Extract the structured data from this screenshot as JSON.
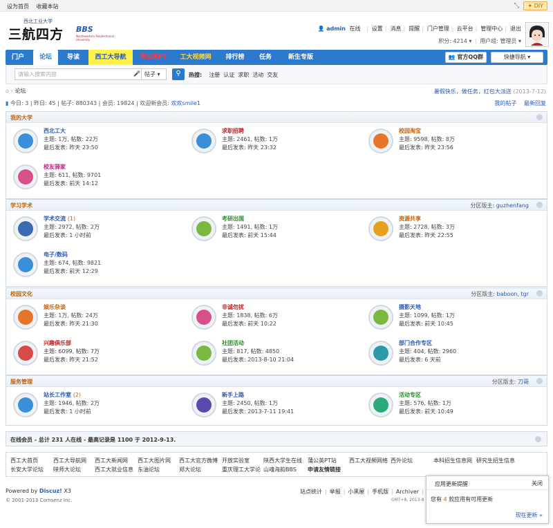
{
  "topbar": {
    "set_home": "设为首页",
    "favorite": "收藏本站",
    "diy": "DIY"
  },
  "logo": {
    "school": "西北工业大学",
    "name": "三航四方",
    "bbs": "BBS",
    "english": "Northwestern Polytechnical University"
  },
  "user": {
    "name": "admin",
    "status": "在线",
    "links": [
      "设置",
      "消息",
      "提醒",
      "门户管理",
      "云平台",
      "管理中心",
      "退出"
    ],
    "points_label": "积分:",
    "points": "4214",
    "group_label": "用户组:",
    "group": "管理员"
  },
  "nav": {
    "items": [
      "门户",
      "论坛",
      "导读",
      "西工大导航",
      "蒲公英PT",
      "工大视频网",
      "排行榜",
      "任务",
      "新生专版"
    ],
    "active": "论坛",
    "qq": "官方QQ群",
    "quicknav": "快捷导航"
  },
  "search": {
    "placeholder": "请输入搜索内容",
    "type": "帖子",
    "hot_label": "热搜:",
    "hot": [
      "注册",
      "认证",
      "求职",
      "活动",
      "交友"
    ]
  },
  "breadcrumb": {
    "current": "论坛",
    "notice": "暑假快乐，做任务，红包大派送",
    "notice_date": "(2013-7-12)"
  },
  "stats": {
    "text": "今日: 3 | 昨日: 45 | 帖子: 880343 | 会员: 19824 | 欢迎新会员:",
    "new_member": "欢欢smile1",
    "my_posts": "我的帖子",
    "latest": "最新回复"
  },
  "sections": [
    {
      "title": "我的大学",
      "mods": "",
      "forums": [
        {
          "name": "西北工大",
          "extra": "",
          "color": "#2b5ab0",
          "icon": "#3a8fd8",
          "topics": "主题: 1万, 帖数: 22万",
          "last": "最后发表: 昨天 23:50"
        },
        {
          "name": "求职招聘",
          "extra": "",
          "color": "#c02020",
          "icon": "#3a8fd8",
          "topics": "主题: 2461, 帖数: 1万",
          "last": "最后发表: 昨天 23:32"
        },
        {
          "name": "校园淘宝",
          "extra": "",
          "color": "#c0620c",
          "icon": "#e8742a",
          "topics": "主题: 9598, 帖数: 8万",
          "last": "最后发表: 昨天 23:56"
        },
        {
          "name": "校友驿家",
          "extra": "",
          "color": "#c02080",
          "icon": "#d8508a",
          "topics": "主题: 611, 帖数: 9701",
          "last": "最后发表: 前天 14:12"
        }
      ]
    },
    {
      "title": "学习学术",
      "mods": "guzhenfang",
      "forums": [
        {
          "name": "学术交流",
          "extra": "(1)",
          "color": "#2b5ab0",
          "icon": "#3a6ab0",
          "topics": "主题: 2972, 帖数: 2万",
          "last": "最后发表: 1 小时前"
        },
        {
          "name": "考研出国",
          "extra": "",
          "color": "#2a8a2a",
          "icon": "#7ab840",
          "topics": "主题: 1491, 帖数: 1万",
          "last": "最后发表: 前天 15:44"
        },
        {
          "name": "资源共享",
          "extra": "",
          "color": "#c0620c",
          "icon": "#e8a020",
          "topics": "主题: 2728, 帖数: 3万",
          "last": "最后发表: 昨天 22:55"
        },
        {
          "name": "电子/数码",
          "extra": "",
          "color": "#2b5ab0",
          "icon": "#3a8fd8",
          "topics": "主题: 674, 帖数: 9821",
          "last": "最后发表: 前天 12:29"
        }
      ]
    },
    {
      "title": "校园文化",
      "mods": "baboon, tgr",
      "forums": [
        {
          "name": "娱乐杂谈",
          "extra": "",
          "color": "#c0620c",
          "icon": "#e8742a",
          "topics": "主题: 1万, 帖数: 24万",
          "last": "最后发表: 昨天 21:30"
        },
        {
          "name": "非诚勿扰",
          "extra": "",
          "color": "#c02020",
          "icon": "#d8508a",
          "topics": "主题: 1838, 帖数: 6万",
          "last": "最后发表: 前天 10:22"
        },
        {
          "name": "摄影天地",
          "extra": "",
          "color": "#2b5ab0",
          "icon": "#7ab840",
          "topics": "主题: 1099, 帖数: 1万",
          "last": "最后发表: 前天 10:45"
        },
        {
          "name": "兴趣俱乐部",
          "extra": "",
          "color": "#c02020",
          "icon": "#d84a4a",
          "topics": "主题: 6099, 帖数: 7万",
          "last": "最后发表: 昨天 21:52"
        },
        {
          "name": "社团活动",
          "extra": "",
          "color": "#2a8a2a",
          "icon": "#7ab840",
          "topics": "主题: 817, 帖数: 4850",
          "last": "最后发表: 2013-8-10 21:04"
        },
        {
          "name": "部门合作专区",
          "extra": "",
          "color": "#2b5ab0",
          "icon": "#2a9aaa",
          "topics": "主题: 404, 帖数: 2960",
          "last": "最后发表: 6 天前"
        }
      ]
    },
    {
      "title": "服务管理",
      "mods": "刀哥",
      "forums": [
        {
          "name": "站长工作室",
          "extra": "(2)",
          "color": "#2b5ab0",
          "icon": "#3a8fd8",
          "topics": "主题: 1946, 帖数: 2万",
          "last": "最后发表: 1 小时前"
        },
        {
          "name": "新手上路",
          "extra": "",
          "color": "#2b5ab0",
          "icon": "#5a4ab0",
          "topics": "主题: 2450, 帖数: 1万",
          "last": "最后发表: 2013-7-11 19:41"
        },
        {
          "name": "活动专区",
          "extra": "",
          "color": "#2a8a2a",
          "icon": "#2aaa7a",
          "topics": "主题: 576, 帖数: 1万",
          "last": "最后发表: 前天 10:49"
        }
      ]
    }
  ],
  "labels": {
    "mods_prefix": "分区版主:"
  },
  "online": {
    "text": "在线会员 - 总计 231 人在线 - 最高记录是 1100 于 2012-9-13."
  },
  "links": [
    "西工大首页",
    "西工大导航网",
    "西工大新闻网",
    "西工大图片网",
    "西工大官方微博",
    "开放实验室",
    "陕西大学生在线",
    "蒲公英PT站",
    "西工大视频网络",
    "西外论坛",
    "本科招生信息网",
    "研究生招生信息",
    "长安大学论坛",
    "陕师大论坛",
    "西工大就业信息",
    "东油论坛",
    "郑大论坛",
    "重庆理工大学论",
    "山魂海韵BBS",
    "申请友情链接"
  ],
  "footer": {
    "powered": "Powered by ",
    "discuz": "Discuz!",
    "version": " X3",
    "copyright": "© 2001-2013 Comsenz Inc.",
    "links": [
      "站点统计",
      "|",
      "举报",
      "|",
      "小黑屋",
      "|",
      "手机版",
      "|",
      "Archiver",
      "|",
      "bl"
    ],
    "gmt": "GMT+8, 2013-8"
  },
  "popup": {
    "title": "应用更新提醒",
    "close": "关闭",
    "pre": "您有",
    "count": "4",
    "post": "款应用有可用更新",
    "more": "现在更新 »"
  }
}
